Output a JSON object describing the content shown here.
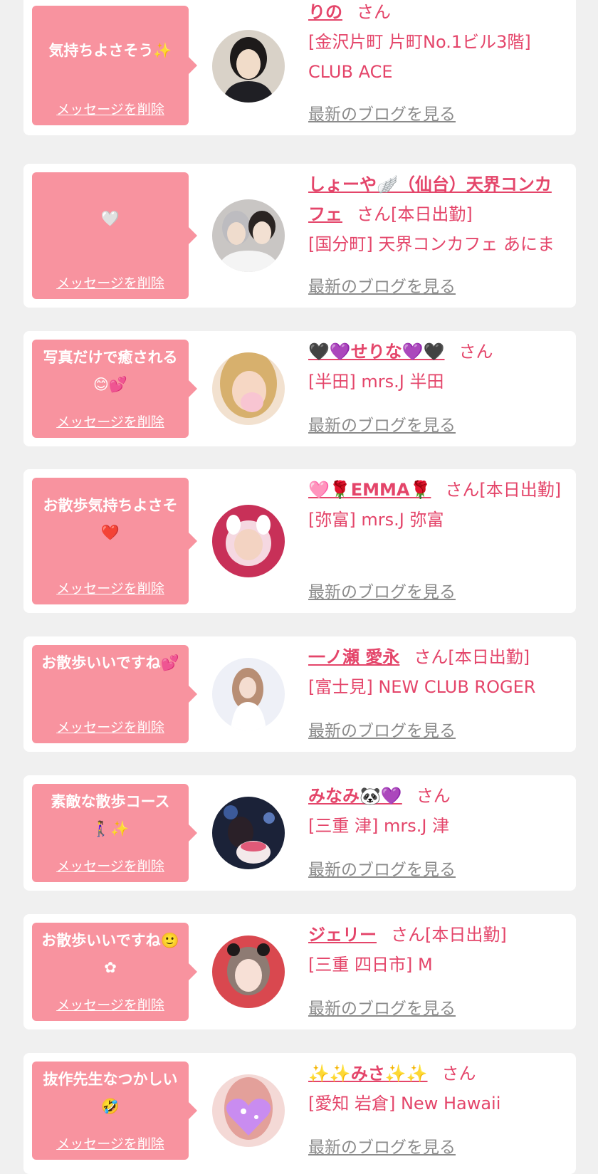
{
  "delete_label": "メッセージを削除",
  "blog_label": "最新のブログを見る",
  "colors": {
    "bubble": "#f8939f",
    "accent": "#e4456a",
    "blog_link": "#8b8b8b",
    "page_bg": "#f0f0f0"
  },
  "items": [
    {
      "message": "気持ちよさそう✨",
      "name": "りの",
      "suffix": "さん",
      "location": "[金沢片町 片町No.1ビル3階] CLUB ACE",
      "avatar": "dark-hair-woman-avatar"
    },
    {
      "message": "🤍",
      "name": "しょーや🪽（仙台）天界コンカフェ",
      "suffix": "さん[本日出勤]",
      "location": "[国分町] 天界コンカフェ あにま",
      "avatar": "two-people-selfie-avatar"
    },
    {
      "message": "写真だけで癒される😊💕",
      "name": "🖤💜せりな💜🖤",
      "suffix": "さん",
      "location": "[半田] mrs.J 半田",
      "avatar": "blonde-woman-avatar"
    },
    {
      "message": "お散歩気持ちよさそ❤️",
      "name": "🩷🌹EMMA🌹",
      "suffix": "さん[本日出勤]",
      "location": "[弥富] mrs.J 弥富",
      "avatar": "pink-frame-avatar"
    },
    {
      "message": "お散歩いいですね💕",
      "name": "一ノ瀬 愛永",
      "suffix": "さん[本日出勤]",
      "location": "[富士見] NEW CLUB ROGER",
      "avatar": "white-dress-woman-avatar"
    },
    {
      "message": "素敵な散歩コース🚶‍♀️✨",
      "name": "みなみ🐼💜",
      "suffix": "さん",
      "location": "[三重 津] mrs.J 津",
      "avatar": "cake-night-avatar"
    },
    {
      "message": "お散歩いいですね🙂✿",
      "name": "ジェリー",
      "suffix": "さん[本日出勤]",
      "location": "[三重 四日市] M",
      "avatar": "red-bg-woman-avatar"
    },
    {
      "message": "抜作先生なつかしい🤣",
      "name": "✨✨みさ✨✨",
      "suffix": "さん",
      "location": "[愛知 岩倉] New Hawaii",
      "avatar": "heart-sticker-avatar"
    }
  ]
}
